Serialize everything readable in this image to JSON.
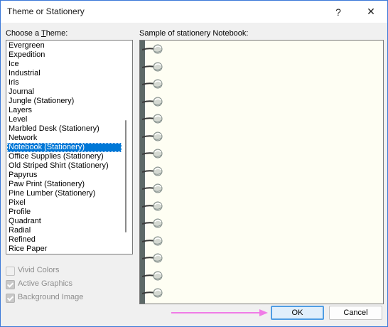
{
  "window": {
    "title": "Theme or Stationery",
    "help_label": "?",
    "close_label": "✕"
  },
  "themes": {
    "label_prefix": "Choose a ",
    "label_underlined": "T",
    "label_suffix": "heme:",
    "items": [
      "Evergreen",
      "Expedition",
      "Ice",
      "Industrial",
      "Iris",
      "Journal",
      "Jungle (Stationery)",
      "Layers",
      "Level",
      "Marbled Desk (Stationery)",
      "Network",
      "Notebook (Stationery)",
      "Office Supplies (Stationery)",
      "Old Striped Shirt (Stationery)",
      "Papyrus",
      "Paw Print (Stationery)",
      "Pine Lumber (Stationery)",
      "Pixel",
      "Profile",
      "Quadrant",
      "Radial",
      "Refined",
      "Rice Paper"
    ],
    "selected": "Notebook (Stationery)"
  },
  "options": [
    {
      "label": "Vivid Colors",
      "checked": false
    },
    {
      "label": "Active Graphics",
      "checked": true
    },
    {
      "label": "Background Image",
      "checked": true
    }
  ],
  "preview": {
    "label": "Sample of stationery Notebook:",
    "paper_color": "#fefef3",
    "spine_color": "#5d6967"
  },
  "buttons": {
    "ok": "OK",
    "cancel": "Cancel"
  },
  "annotation": {
    "arrow_color": "#f07be6"
  }
}
